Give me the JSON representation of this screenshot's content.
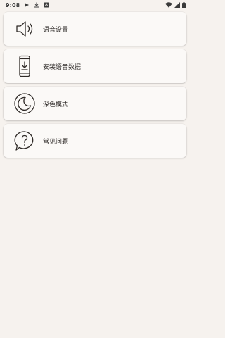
{
  "status_bar": {
    "time": "9:08",
    "icons_left": [
      "send-icon",
      "download-icon",
      "app-badge-icon"
    ],
    "icons_right": [
      "wifi-icon",
      "signal-icon",
      "battery-icon"
    ]
  },
  "menu": {
    "items": [
      {
        "label": "语音设置",
        "icon": "speaker-icon"
      },
      {
        "label": "安装语音数据",
        "icon": "phone-download-icon"
      },
      {
        "label": "深色模式",
        "icon": "moon-icon"
      },
      {
        "label": "常见问题",
        "icon": "question-bubble-icon"
      }
    ]
  },
  "colors": {
    "background": "#f6f2ee",
    "card": "#fbf9f7",
    "text": "#2b2725",
    "icon_stroke": "#2f2a27"
  }
}
